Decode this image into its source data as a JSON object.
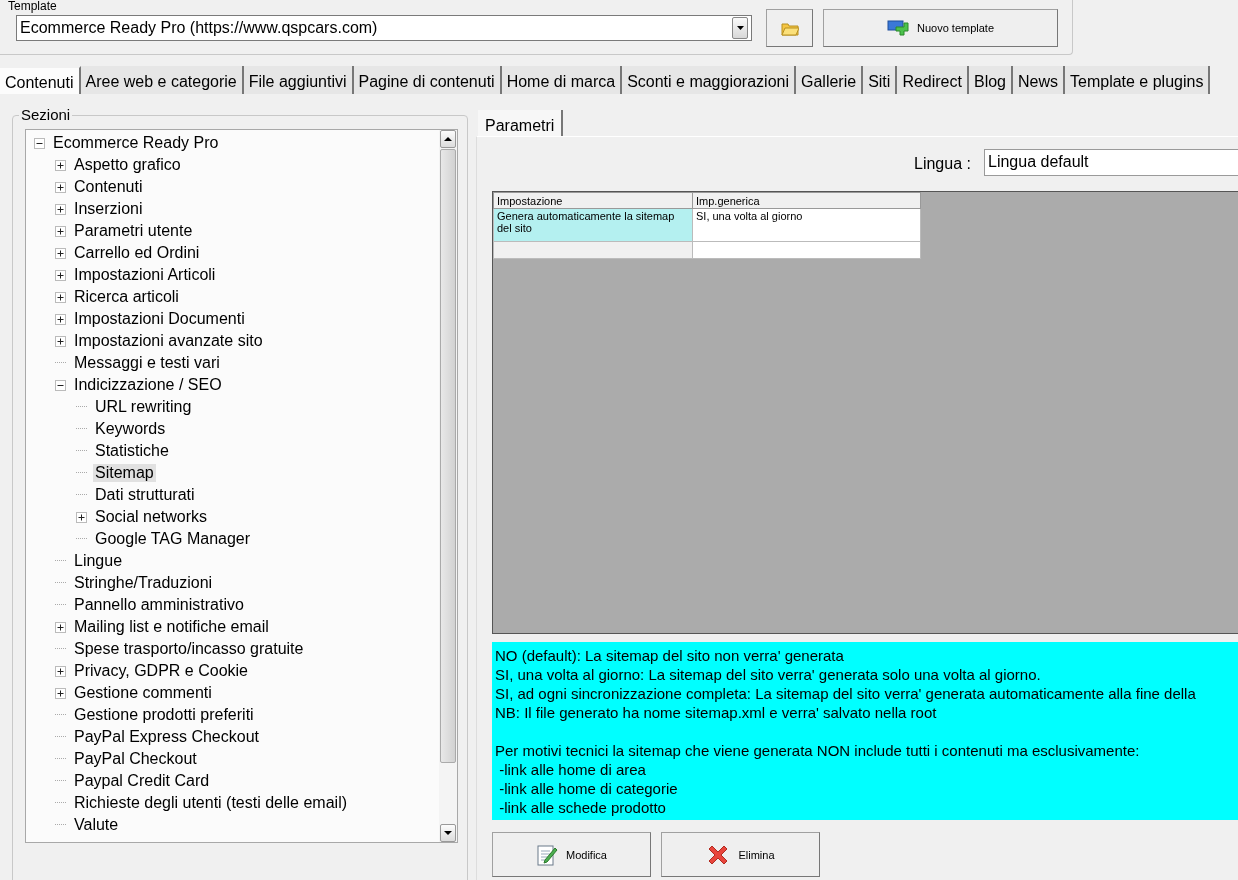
{
  "template": {
    "label": "Template",
    "value": "Ecommerce Ready Pro (https://www.qspcars.com)",
    "new_button": "Nuovo template"
  },
  "tabs": [
    {
      "label": "Contenuti",
      "selected": true
    },
    {
      "label": "Aree web e categorie",
      "selected": false
    },
    {
      "label": "File aggiuntivi",
      "selected": false
    },
    {
      "label": "Pagine di contenuti",
      "selected": false
    },
    {
      "label": "Home di marca",
      "selected": false
    },
    {
      "label": "Sconti e maggiorazioni",
      "selected": false
    },
    {
      "label": "Gallerie",
      "selected": false
    },
    {
      "label": "Siti",
      "selected": false
    },
    {
      "label": "Redirect",
      "selected": false
    },
    {
      "label": "Blog",
      "selected": false
    },
    {
      "label": "News",
      "selected": false
    },
    {
      "label": "Template e plugins",
      "selected": false
    }
  ],
  "sections": {
    "title": "Sezioni",
    "tree": [
      {
        "label": "Ecommerce Ready Pro",
        "expanded": true,
        "selected": false,
        "children": [
          {
            "label": "Aspetto grafico",
            "expanded": false,
            "selected": false
          },
          {
            "label": "Contenuti",
            "expanded": false,
            "selected": false
          },
          {
            "label": "Inserzioni",
            "expanded": false,
            "selected": false
          },
          {
            "label": "Parametri utente",
            "expanded": false,
            "selected": false
          },
          {
            "label": "Carrello ed Ordini",
            "expanded": false,
            "selected": false
          },
          {
            "label": "Impostazioni Articoli",
            "expanded": false,
            "selected": false
          },
          {
            "label": "Ricerca articoli",
            "expanded": false,
            "selected": false
          },
          {
            "label": "Impostazioni Documenti",
            "expanded": false,
            "selected": false
          },
          {
            "label": "Impostazioni avanzate sito",
            "expanded": false,
            "selected": false
          },
          {
            "label": "Messaggi e testi vari",
            "selected": false
          },
          {
            "label": "Indicizzazione / SEO",
            "expanded": true,
            "selected": false,
            "children": [
              {
                "label": "URL rewriting",
                "selected": false
              },
              {
                "label": "Keywords",
                "selected": false
              },
              {
                "label": "Statistiche",
                "selected": false
              },
              {
                "label": "Sitemap",
                "selected": true
              },
              {
                "label": "Dati strutturati",
                "selected": false
              },
              {
                "label": "Social networks",
                "expanded": false,
                "selected": false
              },
              {
                "label": "Google TAG Manager",
                "selected": false
              }
            ]
          },
          {
            "label": "Lingue",
            "selected": false
          },
          {
            "label": "Stringhe/Traduzioni",
            "selected": false
          },
          {
            "label": "Pannello amministrativo",
            "selected": false
          },
          {
            "label": "Mailing list e notifiche email",
            "expanded": false,
            "selected": false
          },
          {
            "label": "Spese trasporto/incasso gratuite",
            "selected": false
          },
          {
            "label": "Privacy, GDPR e Cookie",
            "expanded": false,
            "selected": false
          },
          {
            "label": "Gestione commenti",
            "expanded": false,
            "selected": false
          },
          {
            "label": "Gestione prodotti preferiti",
            "selected": false
          },
          {
            "label": "PayPal Express Checkout",
            "selected": false
          },
          {
            "label": "PayPal Checkout",
            "selected": false
          },
          {
            "label": "Paypal Credit Card",
            "selected": false
          },
          {
            "label": "Richieste degli utenti (testi delle email)",
            "selected": false
          },
          {
            "label": "Valute",
            "selected": false
          }
        ]
      }
    ]
  },
  "panel": {
    "tab": "Parametri",
    "language_label": "Lingua :",
    "language": "Lingua default",
    "table": {
      "columns": [
        "Impostazione",
        "Imp.generica"
      ],
      "rows": [
        {
          "cells": [
            "Genera automaticamente la sitemap del sito",
            "SI, una volta al giorno"
          ],
          "selected": true
        }
      ]
    },
    "description": [
      "NO (default): La sitemap del sito non verra' generata",
      "SI, una volta al giorno: La sitemap del sito verra' generata solo una volta al giorno.",
      "SI, ad ogni sincronizzazione completa: La sitemap del sito verra' generata automaticamente alla fine della",
      "NB: Il file generato ha nome sitemap.xml e verra' salvato nella root",
      "Per motivi tecnici la sitemap che viene generata NON include tutti i contenuti ma esclusivamente:",
      " -link alle home di area",
      " -link alle home di categorie",
      " -link alle schede prodotto"
    ],
    "buttons": [
      {
        "kind": "edit",
        "label": "Modifica"
      },
      {
        "kind": "delete",
        "label": "Elimina"
      }
    ]
  }
}
